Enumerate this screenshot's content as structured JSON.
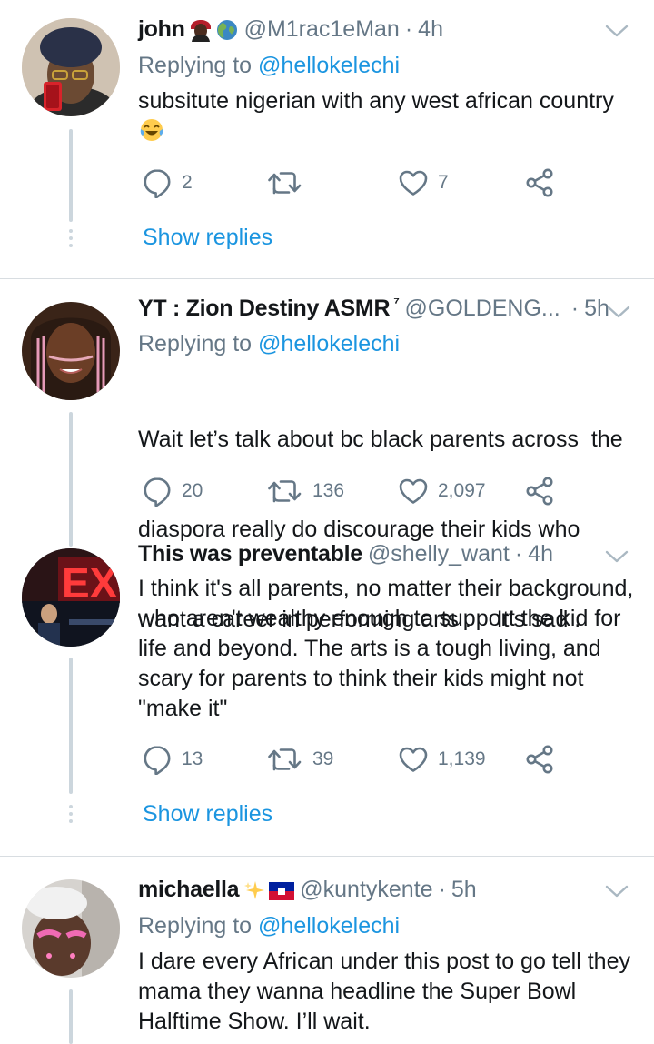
{
  "tweets": [
    {
      "name": "john",
      "handle": "@M1rac1eMan",
      "time": "4h",
      "replying_prefix": "Replying to ",
      "replying_to": "@hellokelechi",
      "text": "subsitute nigerian with any west african country",
      "reply_count": "2",
      "retweet_count": "",
      "like_count": "7",
      "show_replies": "Show replies"
    },
    {
      "name": "YT : Zion Destiny ASMR",
      "name_suffix": "⁷",
      "handle": "@GOLDENG...",
      "time": "5h",
      "replying_prefix": "Replying to ",
      "replying_to": "@hellokelechi",
      "text_lines": [
        "Wait let’s talk about bc black parents across  the",
        "diaspora really do discourage their kids who",
        "want a career in performing arts .    It’s sad ."
      ],
      "reply_count": "20",
      "retweet_count": "136",
      "like_count": "2,097"
    },
    {
      "name": "This was preventable",
      "handle": "@shelly_want",
      "time": "4h",
      "text_lines": [
        "I think it's all parents, no matter their background,",
        "who aren't wealthy enough to support the kid for",
        "life and beyond.  The arts is a tough living, and",
        "scary for parents to think their kids might not",
        "\"make it\""
      ],
      "reply_count": "13",
      "retweet_count": "39",
      "like_count": "1,139",
      "show_replies": "Show replies"
    },
    {
      "name": "michaella",
      "handle": "@kuntykente",
      "time": "5h",
      "replying_prefix": "Replying to ",
      "replying_to": "@hellokelechi",
      "text_lines": [
        "I dare every African under this post to go tell they",
        "mama they wanna headline the Super Bowl",
        "Halftime Show. I’ll wait."
      ]
    }
  ],
  "separator": "·",
  "icons": [
    "reply-icon",
    "retweet-icon",
    "like-icon",
    "share-icon",
    "chevron-down-icon"
  ],
  "colors": {
    "link": "#1b95e0",
    "muted": "#657786",
    "line": "#ccd6dd"
  }
}
